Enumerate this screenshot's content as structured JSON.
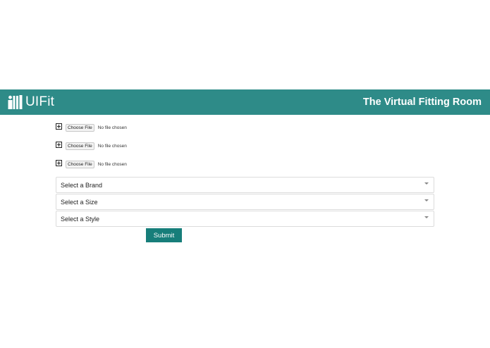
{
  "header": {
    "brand_name": "UIFit",
    "tagline": "The Virtual Fitting Room",
    "background_color": "#2e8b88"
  },
  "uploads": [
    {
      "button_label": "Choose File",
      "status": "No file chosen"
    },
    {
      "button_label": "Choose File",
      "status": "No file chosen"
    },
    {
      "button_label": "Choose File",
      "status": "No file chosen"
    }
  ],
  "selects": {
    "brand": {
      "selected": "Select a Brand"
    },
    "size": {
      "selected": "Select a Size"
    },
    "style": {
      "selected": "Select a Style"
    }
  },
  "submit": {
    "label": "Submit",
    "color": "#177e7a"
  },
  "icons": {
    "brand": "fitting-room-icon",
    "upload": "plus-square-icon",
    "dropdown": "caret-down-icon"
  }
}
